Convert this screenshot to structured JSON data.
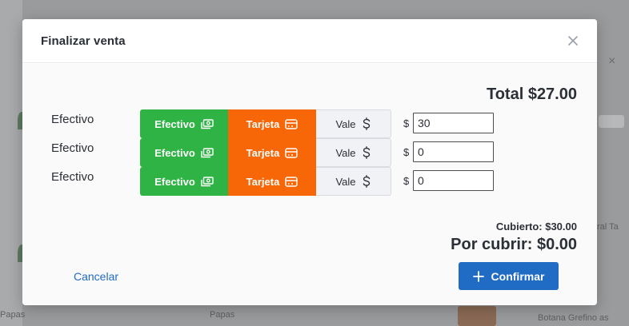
{
  "modal": {
    "title": "Finalizar venta",
    "total": "Total $27.00",
    "payments": [
      {
        "label": "Efectivo",
        "amount": "30"
      },
      {
        "label": "Efectivo",
        "amount": "0"
      },
      {
        "label": "Efectivo",
        "amount": "0"
      }
    ],
    "methods": {
      "cash": "Efectivo",
      "card": "Tarjeta",
      "voucher": "Vale"
    },
    "currency_symbol": "$",
    "covered": "Cubierto: $30.00",
    "remaining": "Por cubrir: $0.00",
    "cancel_label": "Cancelar",
    "confirm_label": "Confirmar"
  },
  "background": {
    "item_a": "Papas",
    "item_b": "Papas",
    "item_c": "Botana Grefino as",
    "side_text": "ral Ta"
  },
  "colors": {
    "cash": "#2fb344",
    "card": "#f76707",
    "primary": "#206bc4"
  },
  "icons": {
    "cash": "cash-icon",
    "card": "credit-card-icon",
    "voucher": "dollar-icon",
    "close": "close-icon",
    "confirm": "plus-icon"
  }
}
